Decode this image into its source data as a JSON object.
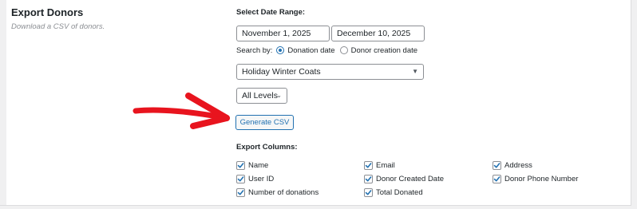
{
  "section": {
    "title": "Export Donors",
    "subtitle": "Download a CSV of donors."
  },
  "date_range": {
    "label": "Select Date Range:",
    "start": "November 1, 2025",
    "end": "December 10, 2025"
  },
  "search_by": {
    "label": "Search by:",
    "options": [
      {
        "label": "Donation date",
        "selected": true
      },
      {
        "label": "Donor creation date",
        "selected": false
      }
    ]
  },
  "form_select": {
    "value": "Holiday Winter Coats"
  },
  "level_select": {
    "value": "All Levels"
  },
  "generate_button": {
    "label": "Generate CSV"
  },
  "export_columns": {
    "label": "Export Columns:",
    "items": [
      {
        "label": "Name",
        "checked": true
      },
      {
        "label": "Email",
        "checked": true
      },
      {
        "label": "Address",
        "checked": true
      },
      {
        "label": "User ID",
        "checked": true
      },
      {
        "label": "Donor Created Date",
        "checked": true
      },
      {
        "label": "Donor Phone Number",
        "checked": true
      },
      {
        "label": "Number of donations",
        "checked": true
      },
      {
        "label": "Total Donated",
        "checked": true
      }
    ]
  },
  "colors": {
    "accent": "#2271b1",
    "annotation_arrow": "#e8141e",
    "page_bg": "#f0f0f1"
  }
}
